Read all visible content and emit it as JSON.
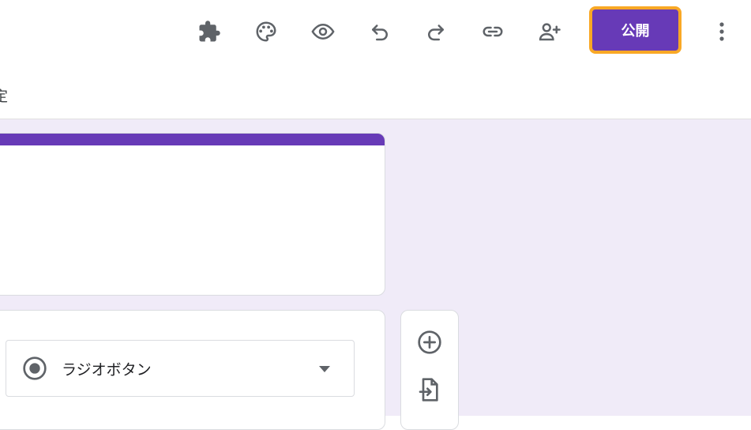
{
  "toolbar": {
    "icons": [
      "puzzle-icon",
      "palette-icon",
      "preview-eye-icon",
      "undo-icon",
      "redo-icon",
      "link-icon",
      "add-collaborator-icon"
    ],
    "publish_label": "公開",
    "more_icon": "more-vert-icon"
  },
  "tabs": {
    "partial_label": "定"
  },
  "question": {
    "type_label": "ラジオボタン",
    "type_icon": "radio-button-icon"
  },
  "side_toolbar": {
    "icons": [
      "add-question-icon",
      "import-questions-icon"
    ]
  },
  "colors": {
    "accent": "#673ab7",
    "canvas_background": "#f0ebf8",
    "focus_ring": "#f9a825"
  }
}
